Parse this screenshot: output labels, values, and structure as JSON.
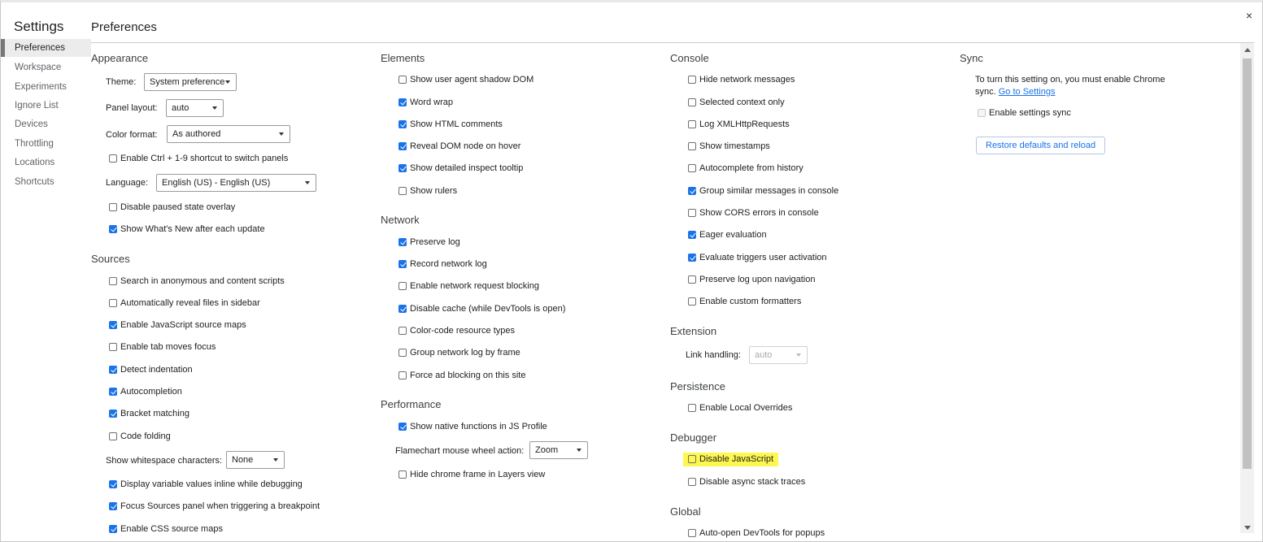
{
  "sidebar": {
    "title": "Settings",
    "items": [
      {
        "label": "Preferences",
        "active": true
      },
      {
        "label": "Workspace"
      },
      {
        "label": "Experiments"
      },
      {
        "label": "Ignore List"
      },
      {
        "label": "Devices"
      },
      {
        "label": "Throttling"
      },
      {
        "label": "Locations"
      },
      {
        "label": "Shortcuts"
      }
    ]
  },
  "header": {
    "title": "Preferences",
    "close_glyph": "×"
  },
  "appearance": {
    "title": "Appearance",
    "theme_label": "Theme:",
    "theme_value": "System preference",
    "panel_layout_label": "Panel layout:",
    "panel_layout_value": "auto",
    "color_format_label": "Color format:",
    "color_format_value": "As authored",
    "ctrl_shortcut": "Enable Ctrl + 1-9 shortcut to switch panels",
    "language_label": "Language:",
    "language_value": "English (US) - English (US)",
    "disable_paused": "Disable paused state overlay",
    "whats_new": "Show What's New after each update"
  },
  "sources": {
    "title": "Sources",
    "anon_scripts": "Search in anonymous and content scripts",
    "reveal_files": "Automatically reveal files in sidebar",
    "js_source_maps": "Enable JavaScript source maps",
    "tab_focus": "Enable tab moves focus",
    "detect_indent": "Detect indentation",
    "autocompletion": "Autocompletion",
    "bracket_matching": "Bracket matching",
    "code_folding": "Code folding",
    "whitespace_label": "Show whitespace characters:",
    "whitespace_value": "None",
    "inline_values": "Display variable values inline while debugging",
    "focus_sources": "Focus Sources panel when triggering a breakpoint",
    "css_source_maps": "Enable CSS source maps"
  },
  "elements": {
    "title": "Elements",
    "shadow_dom": "Show user agent shadow DOM",
    "word_wrap": "Word wrap",
    "html_comments": "Show HTML comments",
    "reveal_dom": "Reveal DOM node on hover",
    "inspect_tooltip": "Show detailed inspect tooltip",
    "rulers": "Show rulers"
  },
  "network": {
    "title": "Network",
    "preserve_log": "Preserve log",
    "record_log": "Record network log",
    "request_blocking": "Enable network request blocking",
    "disable_cache": "Disable cache (while DevTools is open)",
    "color_code": "Color-code resource types",
    "group_by_frame": "Group network log by frame",
    "ad_blocking": "Force ad blocking on this site"
  },
  "performance": {
    "title": "Performance",
    "native_functions": "Show native functions in JS Profile",
    "flamechart_label": "Flamechart mouse wheel action:",
    "flamechart_value": "Zoom",
    "hide_chrome_frame": "Hide chrome frame in Layers view"
  },
  "console": {
    "title": "Console",
    "hide_network": "Hide network messages",
    "selected_context": "Selected context only",
    "log_xhr": "Log XMLHttpRequests",
    "timestamps": "Show timestamps",
    "autocomplete_history": "Autocomplete from history",
    "group_similar": "Group similar messages in console",
    "cors_errors": "Show CORS errors in console",
    "eager_eval": "Eager evaluation",
    "user_activation": "Evaluate triggers user activation",
    "preserve_nav": "Preserve log upon navigation",
    "custom_formatters": "Enable custom formatters"
  },
  "extension": {
    "title": "Extension",
    "link_label": "Link handling:",
    "link_value": "auto"
  },
  "persistence": {
    "title": "Persistence",
    "local_overrides": "Enable Local Overrides"
  },
  "debugger": {
    "title": "Debugger",
    "disable_js": "Disable JavaScript",
    "disable_async": "Disable async stack traces"
  },
  "global": {
    "title": "Global",
    "auto_open": "Auto-open DevTools for popups"
  },
  "sync": {
    "title": "Sync",
    "notice": "To turn this setting on, you must enable Chrome sync.",
    "settings_link": "Go to Settings",
    "enable_sync": "Enable settings sync",
    "restore_button": "Restore defaults and reload"
  },
  "colors": {
    "accent": "#1a73e8",
    "highlight": "#fdf74f"
  }
}
